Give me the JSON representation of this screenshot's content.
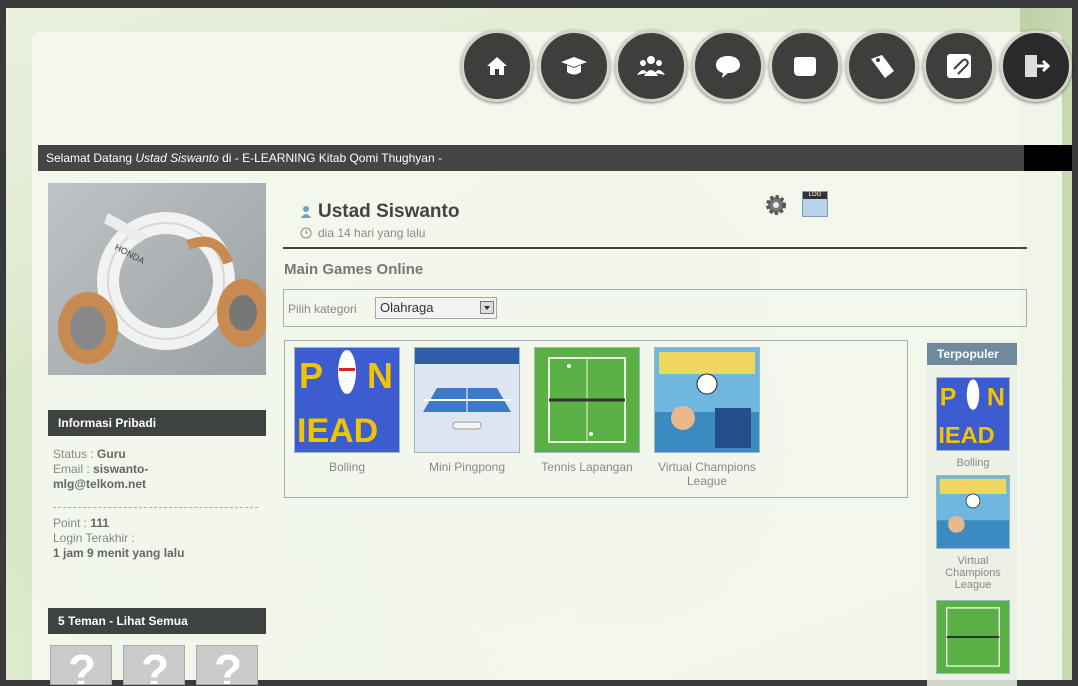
{
  "toolbar": {
    "buttons": [
      {
        "name": "home-icon"
      },
      {
        "name": "graduation-cap-icon"
      },
      {
        "name": "users-icon"
      },
      {
        "name": "chat-icon"
      },
      {
        "name": "shield-icon"
      },
      {
        "name": "tag-icon"
      },
      {
        "name": "paperclip-icon"
      },
      {
        "name": "logout-icon"
      }
    ]
  },
  "welcome": {
    "prefix": "Selamat Datang ",
    "name": "Ustad Siswanto",
    "suffix": " di - E-LEARNING Kitab Qomi Thughyan -"
  },
  "profile": {
    "photo_icon": "scooter-photo",
    "name": "Ustad Siswanto",
    "time": "dia 14 hari yang lalu",
    "settings_icon": "gear-icon",
    "log_icon": "log-icon",
    "log_label": "LOG"
  },
  "info": {
    "title": "Informasi Pribadi",
    "status_label": "Status : ",
    "status_value": "Guru",
    "email_label": "Email : ",
    "email_value_1": "siswanto-",
    "email_value_2": "mlg@telkom.net",
    "point_label": "Point : ",
    "point_value": "111",
    "login_label": "Login Terakhir :",
    "login_value_num": "1",
    "login_value_text": " jam 9 menit yang lalu"
  },
  "friends": {
    "title": "5 Teman - Lihat Semua",
    "placeholder_glyph": "?"
  },
  "games": {
    "title": "Main Games Online",
    "filter_label": "Pilih kategori",
    "filter_value": "Olahraga",
    "items": [
      {
        "label": "Bolling"
      },
      {
        "label": "Mini Pingpong"
      },
      {
        "label": "Tennis Lapangan"
      },
      {
        "label": "Virtual Champions League"
      }
    ]
  },
  "popular": {
    "title": "Terpopuler",
    "items": [
      {
        "label": "Bolling"
      },
      {
        "label": "Virtual Champions League"
      },
      {
        "label": ""
      }
    ]
  }
}
